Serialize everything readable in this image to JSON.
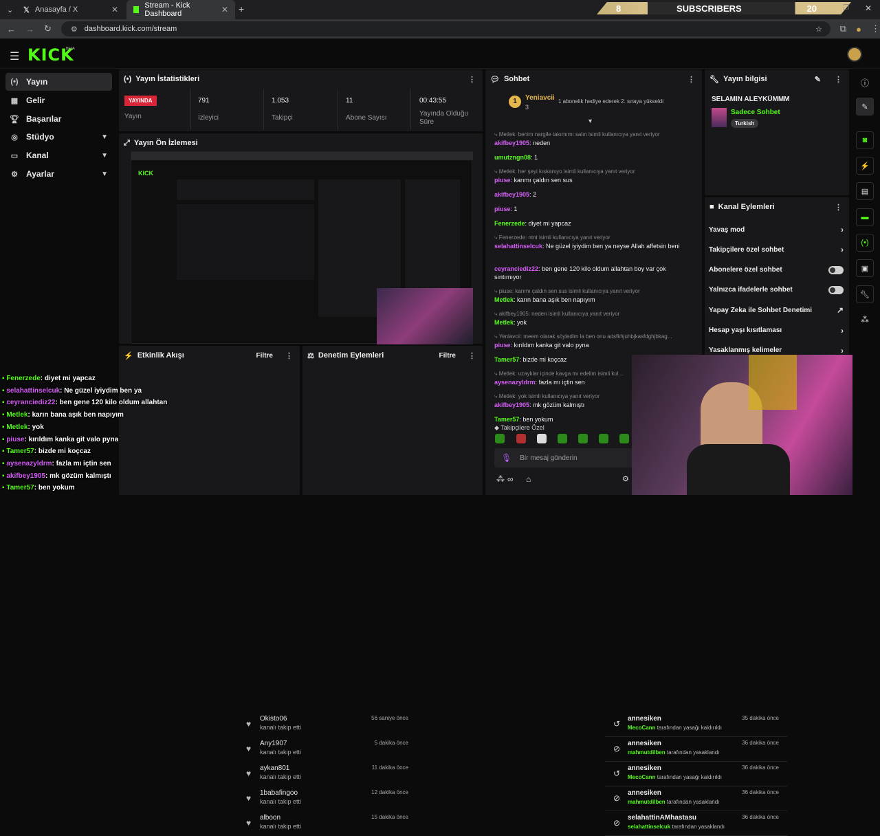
{
  "browser": {
    "tabs": [
      {
        "label": "Anasayfa / X"
      },
      {
        "label": "Stream - Kick Dashboard"
      }
    ],
    "url": "dashboard.kick.com/stream",
    "sub_left": "8",
    "sub_label": "SUBSCRIBERS",
    "sub_right": "20"
  },
  "brand": {
    "logo": "KICK",
    "beta": "BETA"
  },
  "sidebar": {
    "items": [
      {
        "label": "Yayın",
        "icon": "broadcast-icon"
      },
      {
        "label": "Gelir",
        "icon": "revenue-icon"
      },
      {
        "label": "Başarılar",
        "icon": "trophy-icon"
      },
      {
        "label": "Stüdyo",
        "icon": "studio-icon"
      },
      {
        "label": "Kanal",
        "icon": "channel-icon"
      },
      {
        "label": "Ayarlar",
        "icon": "gear-icon"
      }
    ]
  },
  "stats": {
    "title": "Yayın İstatistikleri",
    "live": "YAYINDA",
    "live_label": "Yayın",
    "viewers": "791",
    "viewers_label": "İzleyici",
    "followers": "1.053",
    "followers_label": "Takipçi",
    "subs": "11",
    "subs_label": "Abone Sayısı",
    "uptime": "00:43:55",
    "uptime_label": "Yayında Olduğu Süre"
  },
  "preview": {
    "title": "Yayın Ön İzlemesi"
  },
  "activity": {
    "title": "Etkinlik Akışı",
    "filter": "Filtre",
    "rows": [
      {
        "name": "Okisto06",
        "sub": "kanalı takip etti",
        "time": "56 saniye önce"
      },
      {
        "name": "Any1907",
        "sub": "kanalı takip etti",
        "time": "5 dakika önce"
      },
      {
        "name": "aykan801",
        "sub": "kanalı takip etti",
        "time": "11 dakika önce"
      },
      {
        "name": "1babafingoo",
        "sub": "kanalı takip etti",
        "time": "12 dakika önce"
      },
      {
        "name": "alboon",
        "sub": "kanalı takip etti",
        "time": "15 dakika önce"
      }
    ]
  },
  "moderation": {
    "title": "Denetim Eylemleri",
    "filter": "Filtre",
    "rows": [
      {
        "name": "annesiken",
        "actor": "MecoCann",
        "action": "tarafından yasağı kaldırıldı",
        "time": "35 dakika önce"
      },
      {
        "name": "annesiken",
        "actor": "mahmutdilben",
        "action": "tarafından yasaklandı",
        "time": "36 dakika önce"
      },
      {
        "name": "annesiken",
        "actor": "MecoCann",
        "action": "tarafından yasağı kaldırıldı",
        "time": "36 dakika önce"
      },
      {
        "name": "annesiken",
        "actor": "mahmutdilben",
        "action": "tarafından yasaklandı",
        "time": "36 dakika önce"
      },
      {
        "name": "selahattinAMhastasu",
        "actor": "selahattinselcuk",
        "action": "tarafından yasaklandı",
        "time": "36 dakika önce"
      }
    ]
  },
  "chat": {
    "title": "Sohbet",
    "pinned_user": "Yeniavcii",
    "pinned_count": "3",
    "pinned_msg": "1 abonelik hediye ederek 2. sıraya yükseldi",
    "messages": [
      {
        "reply": "Metlek: benim nargile takımımı salın isimli kullanıcıya yanıt veriyor",
        "user": "akifbey1905",
        "text": "neden",
        "color": "#d65df7"
      },
      {
        "reply": "",
        "user": "umutzngn08",
        "text": "1",
        "color": "#53fc18"
      },
      {
        "reply": "Metlek: her şeyi kıskanıyo isimli kullanıcıya yanıt veriyor",
        "user": "piuse",
        "text": "karımı çaldın sen sus",
        "color": "#d65df7"
      },
      {
        "reply": "",
        "user": "akifbey1905",
        "text": "2",
        "color": "#d65df7"
      },
      {
        "reply": "",
        "user": "piuse",
        "text": "1",
        "color": "#d65df7"
      },
      {
        "reply": "",
        "user": "Fenerzede",
        "text": "diyet mi yapcaz",
        "color": "#53fc18"
      },
      {
        "reply": "Fenerzede: ntnt isimli kullanıcıya yanıt veriyor",
        "user": "selahattinselcuk",
        "text": "Ne güzel iyiydim ben ya neyse Allah affetsin beni",
        "color": "#d65df7"
      },
      {
        "reply": "",
        "user": "ceyranciediz22",
        "text": "ben gene 120 kilo oldum allahtan boy var çok sıntımıyor",
        "color": "#d65df7"
      },
      {
        "reply": "piuse: karımı çaldın sen sus isimli kullanıcıya yanıt veriyor",
        "user": "Metlek",
        "text": "karın bana aşık ben napıyım",
        "color": "#53fc18"
      },
      {
        "reply": "akifbey1905: neden isimli kullanıcıya yanıt veriyor",
        "user": "Metlek",
        "text": "yok",
        "color": "#53fc18"
      },
      {
        "reply": "Yenlavcii: meem olarak söyledim la ben onu adsfkhjuhbjkasfdghjbkag...",
        "user": "piuse",
        "text": "kırıldım kanka git valo pyna",
        "color": "#d65df7"
      },
      {
        "reply": "",
        "user": "Tamer57",
        "text": "bizde mi koçcaz",
        "color": "#53fc18"
      },
      {
        "reply": "Metlek: uzaylılar içinde kavga mı edelim isimli kul...",
        "user": "aysenazyldrm",
        "text": "fazla mı içtin sen",
        "color": "#d65df7"
      },
      {
        "reply": "Metlek: yok isimli kullanıcıya yanıt veriyor",
        "user": "akifbey1905",
        "text": "mk gözüm kalmıştı",
        "color": "#d65df7"
      },
      {
        "reply": "",
        "user": "Tamer57",
        "text": "ben yokum",
        "color": "#53fc18"
      }
    ],
    "followers_only": "Takipçilere Özel",
    "placeholder": "Bir mesaj gönderin"
  },
  "stream_info": {
    "title": "Yayın bilgisi",
    "stream_title": "SELAMIN ALEYKÜMMM",
    "category": "Sadece Sohbet",
    "tag": "Turkish"
  },
  "channel_actions": {
    "title": "Kanal Eylemleri",
    "rows": [
      {
        "label": "Yavaş mod",
        "control": "chevron"
      },
      {
        "label": "Takipçilere özel sohbet",
        "control": "chevron"
      },
      {
        "label": "Abonelere özel sohbet",
        "control": "toggle"
      },
      {
        "label": "Yalnızca ifadelerle sohbet",
        "control": "toggle"
      },
      {
        "label": "Yapay Zeka ile Sohbet Denetimi",
        "control": "external"
      },
      {
        "label": "Hesap yaşı kısıtlaması",
        "control": "chevron"
      },
      {
        "label": "Yasaklanmış kelimeler",
        "control": "chevron"
      }
    ]
  },
  "overlay_chat": [
    {
      "user": "Fenerzede",
      "text": "diyet mi yapcaz",
      "color": "#53fc18"
    },
    {
      "user": "selahattinselcuk",
      "text": "Ne güzel iyiydim ben ya",
      "color": "#d65df7"
    },
    {
      "user": "ceyranciediz22",
      "text": "ben gene 120 kilo oldum allahtan",
      "color": "#d65df7"
    },
    {
      "user": "Metlek",
      "text": "karın bana aşık ben napıyım",
      "color": "#53fc18"
    },
    {
      "user": "Metlek",
      "text": "yok",
      "color": "#53fc18"
    },
    {
      "user": "piuse",
      "text": "kırıldım kanka git valo pyna",
      "color": "#d65df7"
    },
    {
      "user": "Tamer57",
      "text": "bizde mi koçcaz",
      "color": "#53fc18"
    },
    {
      "user": "aysenazyldrm",
      "text": "fazla mı içtin sen",
      "color": "#d65df7"
    },
    {
      "user": "akifbey1905",
      "text": "mk gözüm kalmıştı",
      "color": "#d65df7"
    },
    {
      "user": "Tamer57",
      "text": "ben yokum",
      "color": "#53fc18"
    }
  ],
  "colors": {
    "accent": "#53fc18",
    "live": "#d92538",
    "panel": "#18181b"
  }
}
